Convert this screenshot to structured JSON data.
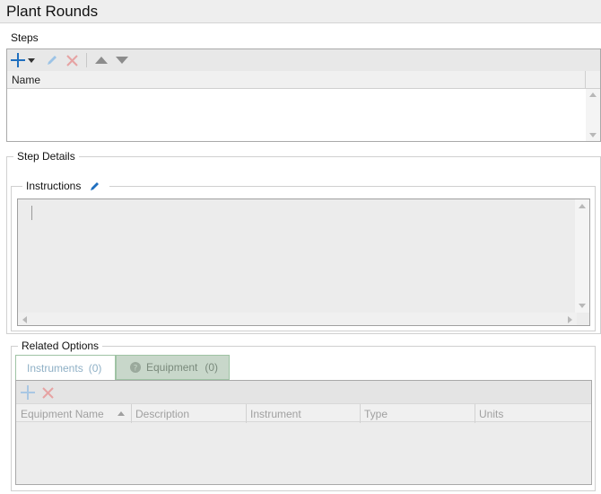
{
  "header": {
    "title": "Plant Rounds"
  },
  "steps": {
    "label": "Steps",
    "toolbar": {
      "add": "plus-icon",
      "add_menu": "caret-down-icon",
      "edit": "pencil-icon",
      "delete": "x-icon",
      "move_up": "triangle-up-icon",
      "move_down": "triangle-down-icon"
    },
    "columns": [
      "Name"
    ],
    "rows": []
  },
  "step_details": {
    "label": "Step Details",
    "instructions": {
      "label": "Instructions",
      "edit_icon": "pencil-icon",
      "value": ""
    }
  },
  "related_options": {
    "label": "Related Options",
    "tabs": [
      {
        "label": "Instruments",
        "count": "(0)",
        "selected": true
      },
      {
        "label": "Equipment",
        "count": "(0)",
        "selected": false,
        "icon": "question-circle-icon"
      }
    ],
    "toolbar": {
      "add": "plus-icon",
      "delete": "x-icon"
    },
    "columns": [
      "Equipment Name",
      "Description",
      "Instrument",
      "Type",
      "Units"
    ],
    "sort_indicator": "sort-ascending-icon",
    "rows": []
  },
  "colors": {
    "accent_blue": "#1f6fbf",
    "delete_red": "#e08a8a",
    "tab_border_green": "#9fc3a4",
    "disabled_gray": "#a0a0a0"
  }
}
